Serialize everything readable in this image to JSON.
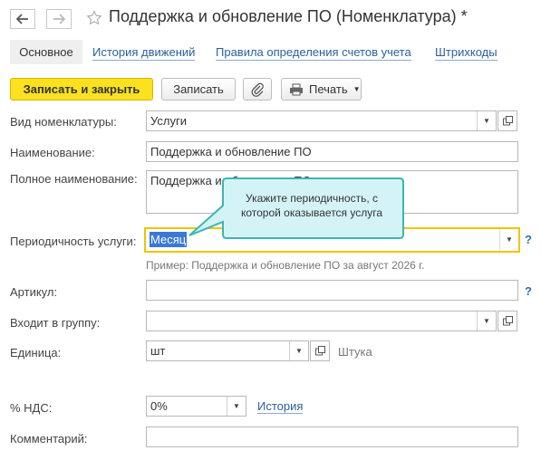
{
  "window": {
    "title": "Поддержка и обновление ПО (Номенклатура) *"
  },
  "tabs": [
    {
      "label": "Основное",
      "active": true
    },
    {
      "label": "История движений"
    },
    {
      "label": "Правила определения счетов учета"
    },
    {
      "label": "Штрихкоды"
    }
  ],
  "toolbar": {
    "save_close_label": "Записать и закрыть",
    "save_label": "Записать",
    "print_label": "Печать"
  },
  "form": {
    "kind_label": "Вид номенклатуры:",
    "kind_value": "Услуги",
    "name_label": "Наименование:",
    "name_value": "Поддержка и обновление ПО",
    "fullname_label": "Полное наименование:",
    "fullname_value": "Поддержка и обновление ПО",
    "period_label": "Периодичность услуги:",
    "period_value": "Месяц",
    "period_example": "Пример: Поддержка и обновление ПО за август 2026 г.",
    "article_label": "Артикул:",
    "article_value": "",
    "group_label": "Входит в группу:",
    "group_value": "",
    "unit_label": "Единица:",
    "unit_value": "шт",
    "unit_full": "Штука",
    "vat_label": "% НДС:",
    "vat_value": "0%",
    "vat_history": "История",
    "comment_label": "Комментарий:",
    "comment_value": "",
    "help_mark": "?"
  },
  "tooltip": {
    "text": "Укажите периодичность, с которой оказывается услуга"
  },
  "colors": {
    "primary_button": "#fbe11f",
    "link": "#2a5f9e",
    "focus_border": "#f0c400",
    "tooltip_bg": "#d4f3f7",
    "tooltip_border": "#3cb6b3",
    "selection": "#3b78d8"
  }
}
